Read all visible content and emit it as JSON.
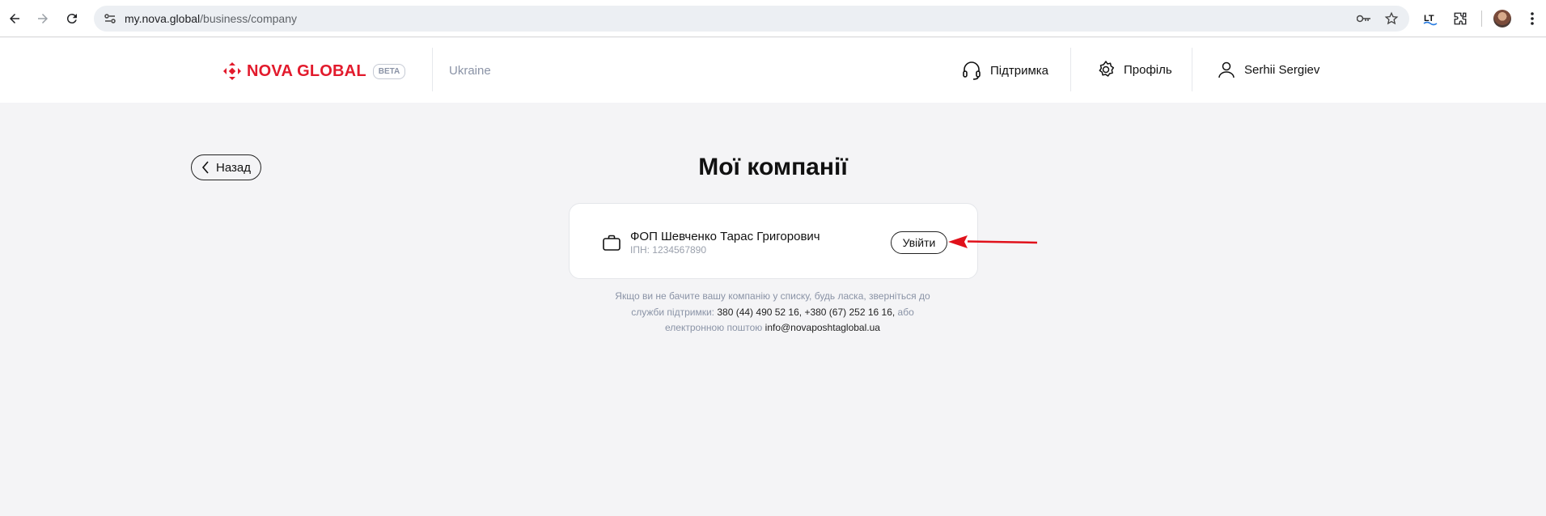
{
  "browser": {
    "url_host": "my.nova.global",
    "url_path": "/business/company",
    "colors": {
      "omnibox": "#eceff3"
    }
  },
  "header": {
    "brand": "NOVA GLOBAL",
    "badge": "BETA",
    "country": "Ukraine",
    "support_label": "Підтримка",
    "profile_label": "Профіль",
    "user_name": "Serhii Sergiev",
    "brand_color": "#e21a2c"
  },
  "main": {
    "back_label": "Назад",
    "title": "Мої компанії",
    "companies": [
      {
        "name": "ФОП Шевченко Тарас Григорович",
        "inn": "ІПН: 1234567890",
        "login_label": "Увійти"
      }
    ],
    "help": {
      "text_1": "Якщо ви не бачите вашу компанію у списку, будь ласка, зверніться до служби підтримки:",
      "phones": "380 (44) 490 52 16, +380 (67) 252 16 16,",
      "text_2": "або електронною поштою",
      "email": "info@novaposhtaglobal.ua"
    }
  },
  "annotation": {
    "arrow_color": "#e0111b"
  }
}
